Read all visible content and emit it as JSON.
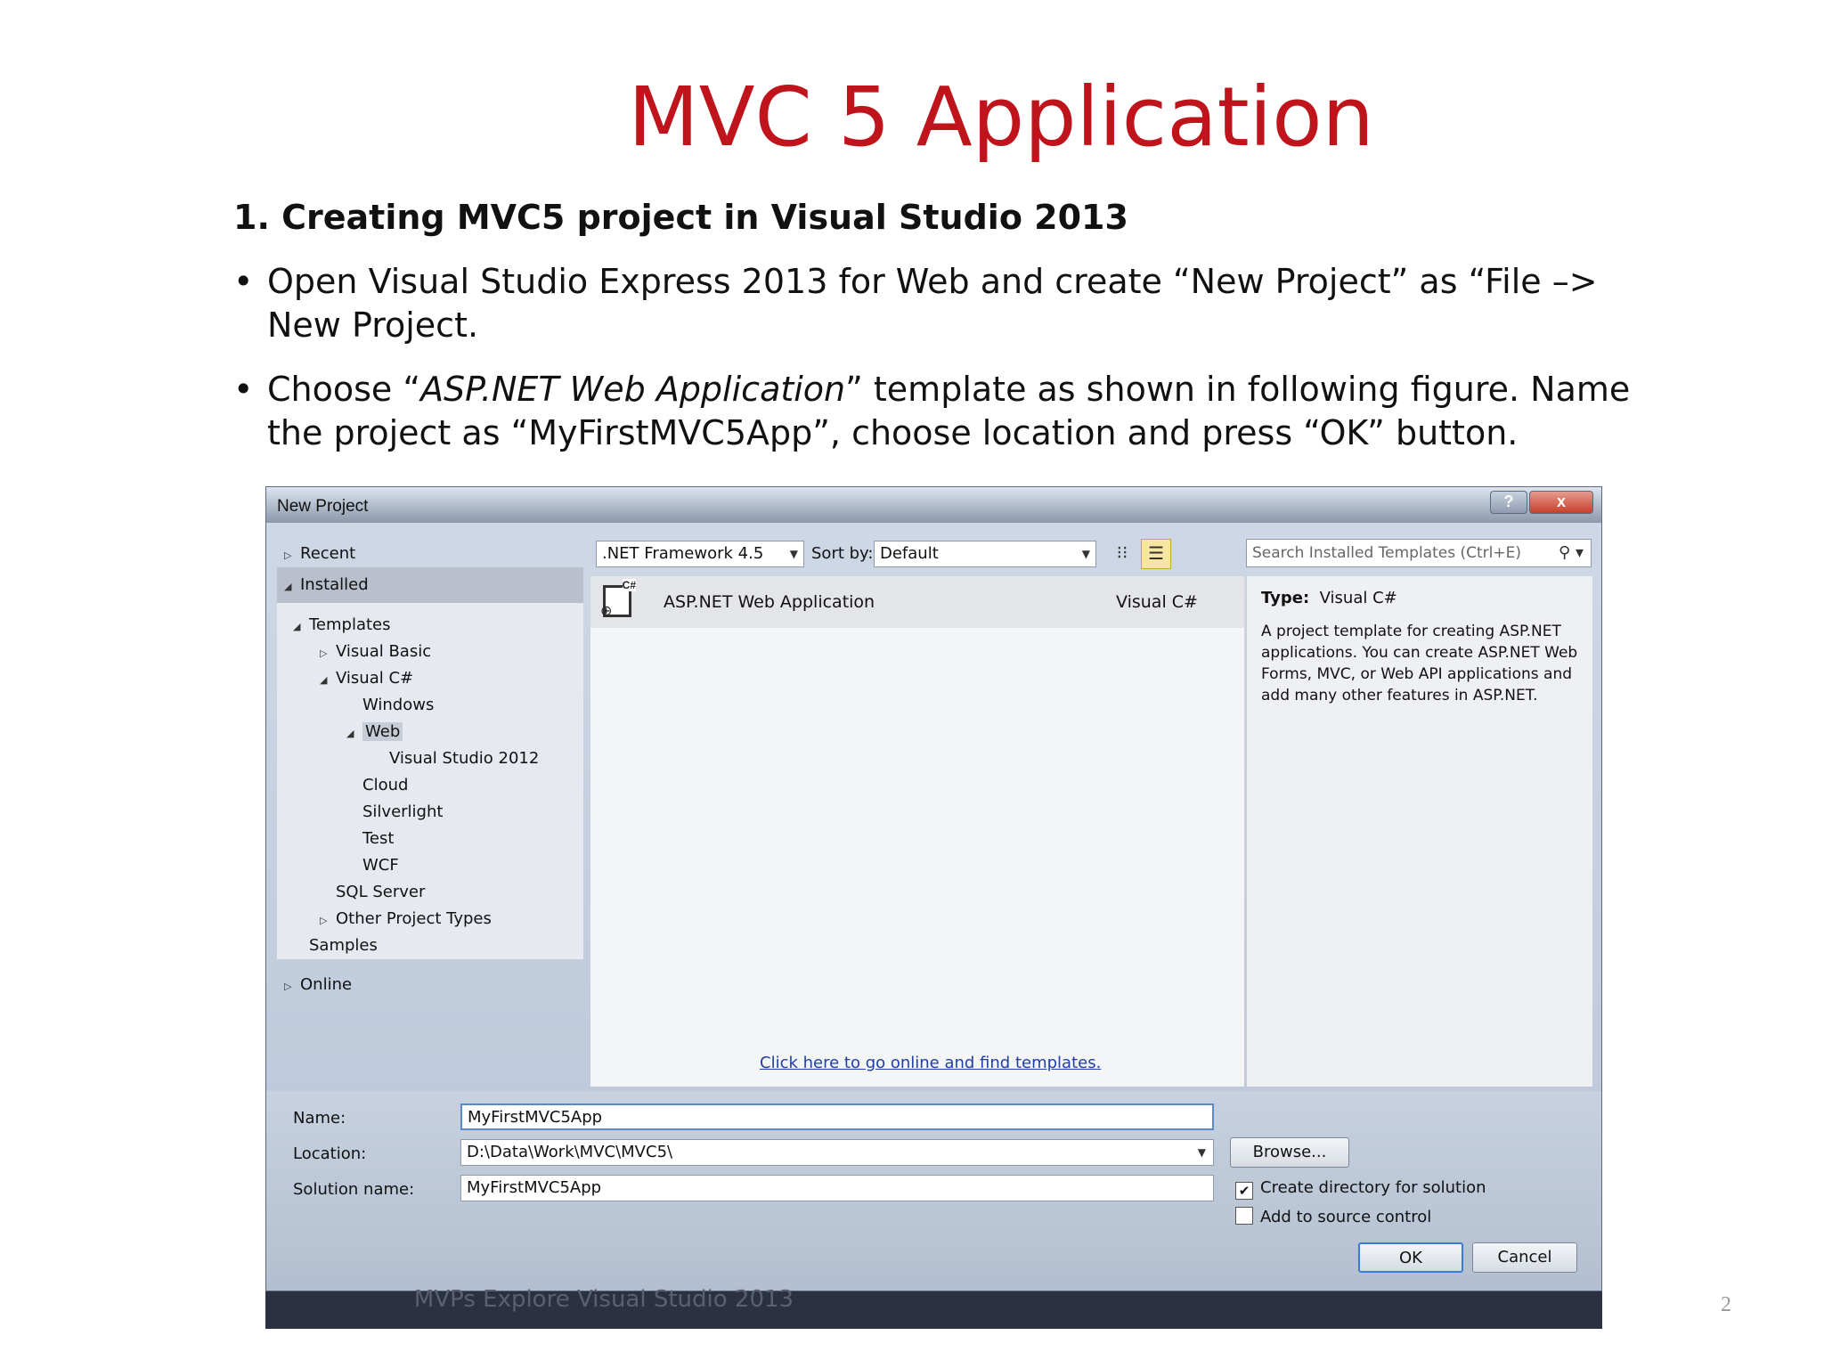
{
  "slide": {
    "title": "MVC 5 Application",
    "heading": "1. Creating MVC5 project in Visual Studio 2013",
    "bullet_char": "•",
    "bullet1": "Open Visual Studio Express 2013 for Web and create “New Project” as “File –> New Project.",
    "bullet2_pre": "Choose “",
    "bullet2_italic": "ASP.NET Web Application",
    "bullet2_post": "” template as shown in following figure. Name the project as “MyFirstMVC5App”, choose location and press “OK” button.",
    "page_number": "2",
    "footer_caption": "MVPs Explore Visual Studio 2013"
  },
  "dialog": {
    "title": "New Project",
    "help_label": "?",
    "close_label": "x",
    "tree": {
      "recent": "Recent",
      "installed": "Installed",
      "templates": "Templates",
      "visual_basic": "Visual Basic",
      "visual_csharp": "Visual C#",
      "windows": "Windows",
      "web": "Web",
      "vs2012": "Visual Studio 2012",
      "cloud": "Cloud",
      "silverlight": "Silverlight",
      "test": "Test",
      "wcf": "WCF",
      "sql_server": "SQL Server",
      "other_project_types": "Other Project Types",
      "samples": "Samples",
      "online": "Online"
    },
    "toolbar": {
      "framework": ".NET Framework 4.5",
      "sort_by_label": "Sort by:",
      "sort_by_value": "Default",
      "search_placeholder": "Search Installed Templates (Ctrl+E)"
    },
    "template": {
      "name": "ASP.NET Web Application",
      "language": "Visual C#",
      "badge": "C#"
    },
    "online_link": "Click here to go online and find templates.",
    "details": {
      "type_label": "Type:",
      "type_value": "Visual C#",
      "description": "A project template for creating ASP.NET applications. You can create ASP.NET Web Forms, MVC,  or Web API applications and add many other features in ASP.NET."
    },
    "form": {
      "name_label": "Name:",
      "name_value": "MyFirstMVC5App",
      "location_label": "Location:",
      "location_value": "D:\\Data\\Work\\MVC\\MVC5\\",
      "solution_label": "Solution name:",
      "solution_value": "MyFirstMVC5App",
      "browse_label": "Browse...",
      "create_dir_label": "Create directory for solution",
      "create_dir_checked": true,
      "source_control_label": "Add to source control",
      "source_control_checked": false,
      "ok_label": "OK",
      "cancel_label": "Cancel"
    }
  }
}
